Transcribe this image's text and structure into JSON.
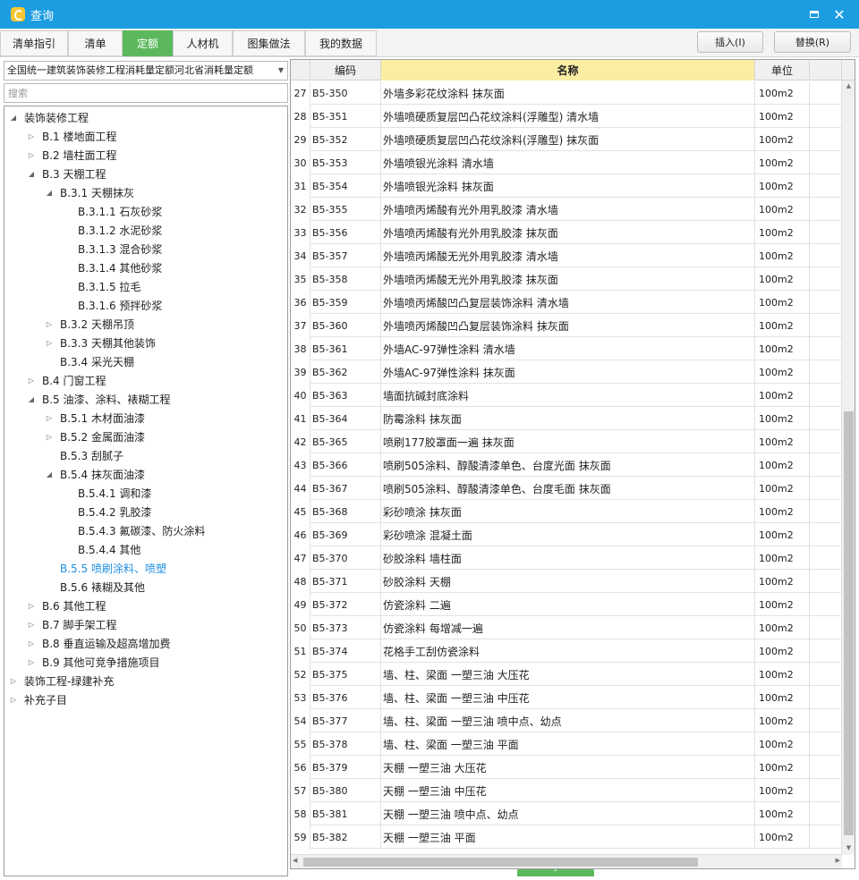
{
  "window": {
    "title": "查询"
  },
  "tabs": [
    {
      "label": "清单指引",
      "active": false
    },
    {
      "label": "清单",
      "active": false
    },
    {
      "label": "定额",
      "active": true
    },
    {
      "label": "人材机",
      "active": false
    },
    {
      "label": "图集做法",
      "active": false
    },
    {
      "label": "我的数据",
      "active": false
    }
  ],
  "actions": {
    "insert": "插入(I)",
    "replace": "替换(R)"
  },
  "left": {
    "dropdown_value": "全国统一建筑装饰装修工程消耗量定额河北省消耗量定额",
    "search_placeholder": "搜索",
    "tree": [
      {
        "label": "装饰装修工程",
        "level": 0,
        "state": "open"
      },
      {
        "label": "B.1 楼地面工程",
        "level": 1,
        "state": "closed"
      },
      {
        "label": "B.2 墙柱面工程",
        "level": 1,
        "state": "closed"
      },
      {
        "label": "B.3 天棚工程",
        "level": 1,
        "state": "open"
      },
      {
        "label": "B.3.1 天棚抹灰",
        "level": 2,
        "state": "open"
      },
      {
        "label": "B.3.1.1 石灰砂浆",
        "level": 3,
        "state": "leaf"
      },
      {
        "label": "B.3.1.2 水泥砂浆",
        "level": 3,
        "state": "leaf"
      },
      {
        "label": "B.3.1.3 混合砂浆",
        "level": 3,
        "state": "leaf"
      },
      {
        "label": "B.3.1.4 其他砂浆",
        "level": 3,
        "state": "leaf"
      },
      {
        "label": "B.3.1.5 拉毛",
        "level": 3,
        "state": "leaf"
      },
      {
        "label": "B.3.1.6 预拌砂浆",
        "level": 3,
        "state": "leaf"
      },
      {
        "label": "B.3.2 天棚吊顶",
        "level": 2,
        "state": "closed"
      },
      {
        "label": "B.3.3 天棚其他装饰",
        "level": 2,
        "state": "closed"
      },
      {
        "label": "B.3.4 采光天棚",
        "level": 2,
        "state": "leaf"
      },
      {
        "label": "B.4 门窗工程",
        "level": 1,
        "state": "closed"
      },
      {
        "label": "B.5 油漆、涂料、裱糊工程",
        "level": 1,
        "state": "open"
      },
      {
        "label": "B.5.1 木材面油漆",
        "level": 2,
        "state": "closed"
      },
      {
        "label": "B.5.2 金属面油漆",
        "level": 2,
        "state": "closed"
      },
      {
        "label": "B.5.3 刮腻子",
        "level": 2,
        "state": "leaf"
      },
      {
        "label": "B.5.4 抹灰面油漆",
        "level": 2,
        "state": "open"
      },
      {
        "label": "B.5.4.1 调和漆",
        "level": 3,
        "state": "leaf"
      },
      {
        "label": "B.5.4.2 乳胶漆",
        "level": 3,
        "state": "leaf"
      },
      {
        "label": "B.5.4.3 氟碳漆、防火涂料",
        "level": 3,
        "state": "leaf"
      },
      {
        "label": "B.5.4.4 其他",
        "level": 3,
        "state": "leaf"
      },
      {
        "label": "B.5.5 喷刷涂料、喷塑",
        "level": 2,
        "state": "leaf",
        "selected": true
      },
      {
        "label": "B.5.6 裱糊及其他",
        "level": 2,
        "state": "leaf"
      },
      {
        "label": "B.6 其他工程",
        "level": 1,
        "state": "closed"
      },
      {
        "label": "B.7 脚手架工程",
        "level": 1,
        "state": "closed"
      },
      {
        "label": "B.8 垂直运输及超高增加费",
        "level": 1,
        "state": "closed"
      },
      {
        "label": "B.9 其他可竞争措施项目",
        "level": 1,
        "state": "closed"
      },
      {
        "label": "装饰工程-绿建补充",
        "level": 0,
        "state": "closed"
      },
      {
        "label": "补充子目",
        "level": 0,
        "state": "closed"
      }
    ]
  },
  "table": {
    "columns": {
      "code": "编码",
      "name": "名称",
      "unit": "单位"
    },
    "rows": [
      {
        "idx": "27",
        "code": "B5-350",
        "name": "外墙多彩花纹涂料 抹灰面",
        "unit": "100m2"
      },
      {
        "idx": "28",
        "code": "B5-351",
        "name": "外墙喷硬质复层凹凸花纹涂料(浮雕型) 清水墙",
        "unit": "100m2"
      },
      {
        "idx": "29",
        "code": "B5-352",
        "name": "外墙喷硬质复层凹凸花纹涂料(浮雕型) 抹灰面",
        "unit": "100m2"
      },
      {
        "idx": "30",
        "code": "B5-353",
        "name": "外墙喷银光涂料 清水墙",
        "unit": "100m2"
      },
      {
        "idx": "31",
        "code": "B5-354",
        "name": "外墙喷银光涂料 抹灰面",
        "unit": "100m2"
      },
      {
        "idx": "32",
        "code": "B5-355",
        "name": "外墙喷丙烯酸有光外用乳胶漆 清水墙",
        "unit": "100m2"
      },
      {
        "idx": "33",
        "code": "B5-356",
        "name": "外墙喷丙烯酸有光外用乳胶漆 抹灰面",
        "unit": "100m2"
      },
      {
        "idx": "34",
        "code": "B5-357",
        "name": "外墙喷丙烯酸无光外用乳胶漆 清水墙",
        "unit": "100m2"
      },
      {
        "idx": "35",
        "code": "B5-358",
        "name": "外墙喷丙烯酸无光外用乳胶漆 抹灰面",
        "unit": "100m2"
      },
      {
        "idx": "36",
        "code": "B5-359",
        "name": "外墙喷丙烯酸凹凸复层装饰涂料 清水墙",
        "unit": "100m2"
      },
      {
        "idx": "37",
        "code": "B5-360",
        "name": "外墙喷丙烯酸凹凸复层装饰涂料 抹灰面",
        "unit": "100m2"
      },
      {
        "idx": "38",
        "code": "B5-361",
        "name": "外墙AC-97弹性涂料 清水墙",
        "unit": "100m2"
      },
      {
        "idx": "39",
        "code": "B5-362",
        "name": "外墙AC-97弹性涂料 抹灰面",
        "unit": "100m2"
      },
      {
        "idx": "40",
        "code": "B5-363",
        "name": "墙面抗碱封底涂料",
        "unit": "100m2"
      },
      {
        "idx": "41",
        "code": "B5-364",
        "name": "防霉涂料 抹灰面",
        "unit": "100m2"
      },
      {
        "idx": "42",
        "code": "B5-365",
        "name": "喷刷177胶罩面一遍 抹灰面",
        "unit": "100m2"
      },
      {
        "idx": "43",
        "code": "B5-366",
        "name": "喷刷505涂料、醇酸清漆单色、台度光面 抹灰面",
        "unit": "100m2"
      },
      {
        "idx": "44",
        "code": "B5-367",
        "name": "喷刷505涂料、醇酸清漆单色、台度毛面 抹灰面",
        "unit": "100m2"
      },
      {
        "idx": "45",
        "code": "B5-368",
        "name": "彩砂喷涂 抹灰面",
        "unit": "100m2"
      },
      {
        "idx": "46",
        "code": "B5-369",
        "name": "彩砂喷涂 混凝土面",
        "unit": "100m2"
      },
      {
        "idx": "47",
        "code": "B5-370",
        "name": "砂胶涂料 墙柱面",
        "unit": "100m2"
      },
      {
        "idx": "48",
        "code": "B5-371",
        "name": "砂胶涂料 天棚",
        "unit": "100m2"
      },
      {
        "idx": "49",
        "code": "B5-372",
        "name": "仿瓷涂料 二遍",
        "unit": "100m2"
      },
      {
        "idx": "50",
        "code": "B5-373",
        "name": "仿瓷涂料 每增减一遍",
        "unit": "100m2"
      },
      {
        "idx": "51",
        "code": "B5-374",
        "name": "花格手工刮仿瓷涂料",
        "unit": "100m2"
      },
      {
        "idx": "52",
        "code": "B5-375",
        "name": "墙、柱、梁面 一塑三油 大压花",
        "unit": "100m2"
      },
      {
        "idx": "53",
        "code": "B5-376",
        "name": "墙、柱、梁面 一塑三油 中压花",
        "unit": "100m2"
      },
      {
        "idx": "54",
        "code": "B5-377",
        "name": "墙、柱、梁面 一塑三油 喷中点、幼点",
        "unit": "100m2"
      },
      {
        "idx": "55",
        "code": "B5-378",
        "name": "墙、柱、梁面 一塑三油 平面",
        "unit": "100m2"
      },
      {
        "idx": "56",
        "code": "B5-379",
        "name": "天棚 一塑三油 大压花",
        "unit": "100m2"
      },
      {
        "idx": "57",
        "code": "B5-380",
        "name": "天棚 一塑三油 中压花",
        "unit": "100m2"
      },
      {
        "idx": "58",
        "code": "B5-381",
        "name": "天棚 一塑三油 喷中点、幼点",
        "unit": "100m2"
      },
      {
        "idx": "59",
        "code": "B5-382",
        "name": "天棚 一塑三油 平面",
        "unit": "100m2"
      }
    ]
  },
  "colors": {
    "titlebar": "#1c9de2",
    "active_tab": "#5cb85c",
    "name_header": "#fbeea3",
    "selected_tree": "#1e8fe0"
  }
}
